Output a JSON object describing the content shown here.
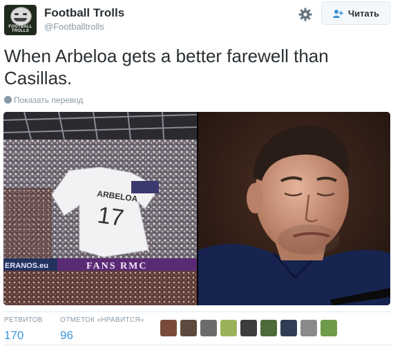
{
  "header": {
    "display_name": "Football Trolls",
    "handle": "@Footballtrolls",
    "avatar_brand": "FOOTBALL TROLLS",
    "follow_label": "Читать"
  },
  "tweet": {
    "text": "When Arbeloa gets a better farewell than Casillas.",
    "translate_label": "Показать перевод"
  },
  "media": {
    "left_photo": {
      "shirt_name": "ARBELOA",
      "shirt_number": "17",
      "banner_text": "FANS RMC",
      "ad_text": "ERANOS.eu"
    }
  },
  "stats": {
    "retweets_label": "РЕТВИТОВ",
    "retweets_value": "170",
    "likes_label": "ОТМЕТОК «НРАВИТСЯ»",
    "likes_value": "96"
  },
  "likers": {
    "colors": [
      "#7a4b3a",
      "#5d4a3e",
      "#6b6b6b",
      "#9ab35a",
      "#3d3d3d",
      "#4d6b3a",
      "#2f3e55",
      "#8a8a8a",
      "#6f9a4a"
    ]
  },
  "colors": {
    "accent": "#3b94d9",
    "muted": "#8899a6",
    "text": "#292f33"
  }
}
